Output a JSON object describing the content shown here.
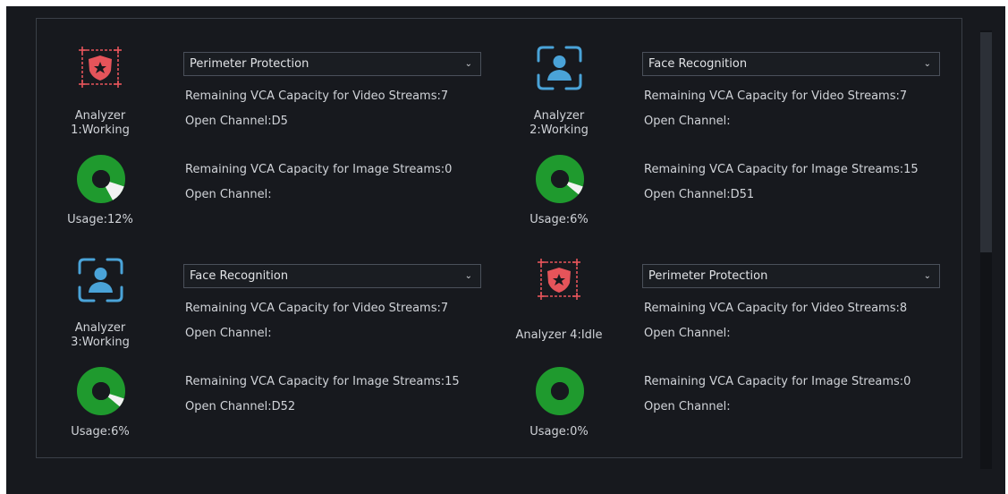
{
  "analyzers": [
    {
      "name": "Analyzer\n1:Working",
      "icon": "perimeter-shield-icon",
      "usage_label": "Usage:12%",
      "usage_percent": 12,
      "function": "Perimeter Protection",
      "video_capacity": "Remaining VCA Capacity for Video Streams:7",
      "video_channel": "Open Channel:D5",
      "image_capacity": "Remaining VCA Capacity for Image Streams:0",
      "image_channel": "Open Channel:"
    },
    {
      "name": "Analyzer\n2:Working",
      "icon": "face-recognition-icon",
      "usage_label": "Usage:6%",
      "usage_percent": 6,
      "function": "Face Recognition",
      "video_capacity": "Remaining VCA Capacity for Video Streams:7",
      "video_channel": "Open Channel:",
      "image_capacity": "Remaining VCA Capacity for Image Streams:15",
      "image_channel": "Open Channel:D51"
    },
    {
      "name": "Analyzer\n3:Working",
      "icon": "face-recognition-icon",
      "usage_label": "Usage:6%",
      "usage_percent": 6,
      "function": "Face Recognition",
      "video_capacity": "Remaining VCA Capacity for Video Streams:7",
      "video_channel": "Open Channel:",
      "image_capacity": "Remaining VCA Capacity for Image Streams:15",
      "image_channel": "Open Channel:D52"
    },
    {
      "name": "Analyzer 4:Idle",
      "icon": "perimeter-shield-icon",
      "usage_label": "Usage:0%",
      "usage_percent": 0,
      "function": "Perimeter Protection",
      "video_capacity": "Remaining VCA Capacity for Video Streams:8",
      "video_channel": "Open Channel:",
      "image_capacity": "Remaining VCA Capacity for Image Streams:0",
      "image_channel": "Open Channel:"
    }
  ],
  "colors": {
    "background": "#17191e",
    "donut_green": "#1f9a2e",
    "donut_used": "#f2f2f2",
    "perimeter_red": "#e5545a",
    "face_blue": "#4aa3d8"
  }
}
